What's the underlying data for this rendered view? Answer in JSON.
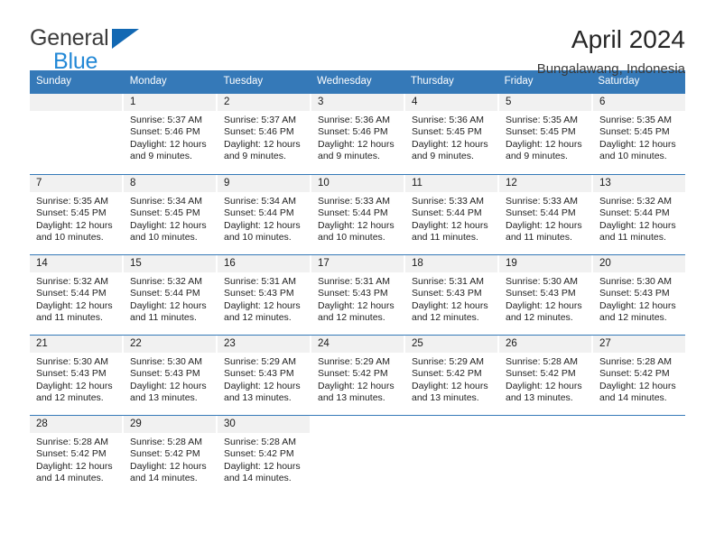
{
  "brand": {
    "name_part1": "General",
    "name_part2": "Blue",
    "logo_icon": "triangle-flag-icon"
  },
  "header": {
    "title": "April 2024",
    "subtitle": "Bungalawang, Indonesia"
  },
  "colors": {
    "header_blue": "#3579b8",
    "brand_dark": "#3c3c3c",
    "brand_blue": "#2288d6",
    "day_band_gray": "#f1f1f1"
  },
  "weekdays": [
    "Sunday",
    "Monday",
    "Tuesday",
    "Wednesday",
    "Thursday",
    "Friday",
    "Saturday"
  ],
  "labels": {
    "sunrise": "Sunrise:",
    "sunset": "Sunset:",
    "daylight": "Daylight:"
  },
  "weeks": [
    [
      {
        "day": "",
        "empty": true
      },
      {
        "day": "1",
        "sunrise": "Sunrise: 5:37 AM",
        "sunset": "Sunset: 5:46 PM",
        "daylight": "Daylight: 12 hours and 9 minutes."
      },
      {
        "day": "2",
        "sunrise": "Sunrise: 5:37 AM",
        "sunset": "Sunset: 5:46 PM",
        "daylight": "Daylight: 12 hours and 9 minutes."
      },
      {
        "day": "3",
        "sunrise": "Sunrise: 5:36 AM",
        "sunset": "Sunset: 5:46 PM",
        "daylight": "Daylight: 12 hours and 9 minutes."
      },
      {
        "day": "4",
        "sunrise": "Sunrise: 5:36 AM",
        "sunset": "Sunset: 5:45 PM",
        "daylight": "Daylight: 12 hours and 9 minutes."
      },
      {
        "day": "5",
        "sunrise": "Sunrise: 5:35 AM",
        "sunset": "Sunset: 5:45 PM",
        "daylight": "Daylight: 12 hours and 9 minutes."
      },
      {
        "day": "6",
        "sunrise": "Sunrise: 5:35 AM",
        "sunset": "Sunset: 5:45 PM",
        "daylight": "Daylight: 12 hours and 10 minutes."
      }
    ],
    [
      {
        "day": "7",
        "sunrise": "Sunrise: 5:35 AM",
        "sunset": "Sunset: 5:45 PM",
        "daylight": "Daylight: 12 hours and 10 minutes."
      },
      {
        "day": "8",
        "sunrise": "Sunrise: 5:34 AM",
        "sunset": "Sunset: 5:45 PM",
        "daylight": "Daylight: 12 hours and 10 minutes."
      },
      {
        "day": "9",
        "sunrise": "Sunrise: 5:34 AM",
        "sunset": "Sunset: 5:44 PM",
        "daylight": "Daylight: 12 hours and 10 minutes."
      },
      {
        "day": "10",
        "sunrise": "Sunrise: 5:33 AM",
        "sunset": "Sunset: 5:44 PM",
        "daylight": "Daylight: 12 hours and 10 minutes."
      },
      {
        "day": "11",
        "sunrise": "Sunrise: 5:33 AM",
        "sunset": "Sunset: 5:44 PM",
        "daylight": "Daylight: 12 hours and 11 minutes."
      },
      {
        "day": "12",
        "sunrise": "Sunrise: 5:33 AM",
        "sunset": "Sunset: 5:44 PM",
        "daylight": "Daylight: 12 hours and 11 minutes."
      },
      {
        "day": "13",
        "sunrise": "Sunrise: 5:32 AM",
        "sunset": "Sunset: 5:44 PM",
        "daylight": "Daylight: 12 hours and 11 minutes."
      }
    ],
    [
      {
        "day": "14",
        "sunrise": "Sunrise: 5:32 AM",
        "sunset": "Sunset: 5:44 PM",
        "daylight": "Daylight: 12 hours and 11 minutes."
      },
      {
        "day": "15",
        "sunrise": "Sunrise: 5:32 AM",
        "sunset": "Sunset: 5:44 PM",
        "daylight": "Daylight: 12 hours and 11 minutes."
      },
      {
        "day": "16",
        "sunrise": "Sunrise: 5:31 AM",
        "sunset": "Sunset: 5:43 PM",
        "daylight": "Daylight: 12 hours and 12 minutes."
      },
      {
        "day": "17",
        "sunrise": "Sunrise: 5:31 AM",
        "sunset": "Sunset: 5:43 PM",
        "daylight": "Daylight: 12 hours and 12 minutes."
      },
      {
        "day": "18",
        "sunrise": "Sunrise: 5:31 AM",
        "sunset": "Sunset: 5:43 PM",
        "daylight": "Daylight: 12 hours and 12 minutes."
      },
      {
        "day": "19",
        "sunrise": "Sunrise: 5:30 AM",
        "sunset": "Sunset: 5:43 PM",
        "daylight": "Daylight: 12 hours and 12 minutes."
      },
      {
        "day": "20",
        "sunrise": "Sunrise: 5:30 AM",
        "sunset": "Sunset: 5:43 PM",
        "daylight": "Daylight: 12 hours and 12 minutes."
      }
    ],
    [
      {
        "day": "21",
        "sunrise": "Sunrise: 5:30 AM",
        "sunset": "Sunset: 5:43 PM",
        "daylight": "Daylight: 12 hours and 12 minutes."
      },
      {
        "day": "22",
        "sunrise": "Sunrise: 5:30 AM",
        "sunset": "Sunset: 5:43 PM",
        "daylight": "Daylight: 12 hours and 13 minutes."
      },
      {
        "day": "23",
        "sunrise": "Sunrise: 5:29 AM",
        "sunset": "Sunset: 5:43 PM",
        "daylight": "Daylight: 12 hours and 13 minutes."
      },
      {
        "day": "24",
        "sunrise": "Sunrise: 5:29 AM",
        "sunset": "Sunset: 5:42 PM",
        "daylight": "Daylight: 12 hours and 13 minutes."
      },
      {
        "day": "25",
        "sunrise": "Sunrise: 5:29 AM",
        "sunset": "Sunset: 5:42 PM",
        "daylight": "Daylight: 12 hours and 13 minutes."
      },
      {
        "day": "26",
        "sunrise": "Sunrise: 5:28 AM",
        "sunset": "Sunset: 5:42 PM",
        "daylight": "Daylight: 12 hours and 13 minutes."
      },
      {
        "day": "27",
        "sunrise": "Sunrise: 5:28 AM",
        "sunset": "Sunset: 5:42 PM",
        "daylight": "Daylight: 12 hours and 14 minutes."
      }
    ],
    [
      {
        "day": "28",
        "sunrise": "Sunrise: 5:28 AM",
        "sunset": "Sunset: 5:42 PM",
        "daylight": "Daylight: 12 hours and 14 minutes."
      },
      {
        "day": "29",
        "sunrise": "Sunrise: 5:28 AM",
        "sunset": "Sunset: 5:42 PM",
        "daylight": "Daylight: 12 hours and 14 minutes."
      },
      {
        "day": "30",
        "sunrise": "Sunrise: 5:28 AM",
        "sunset": "Sunset: 5:42 PM",
        "daylight": "Daylight: 12 hours and 14 minutes."
      },
      {
        "day": "",
        "blank": true
      },
      {
        "day": "",
        "blank": true
      },
      {
        "day": "",
        "blank": true
      },
      {
        "day": "",
        "blank": true
      }
    ]
  ]
}
